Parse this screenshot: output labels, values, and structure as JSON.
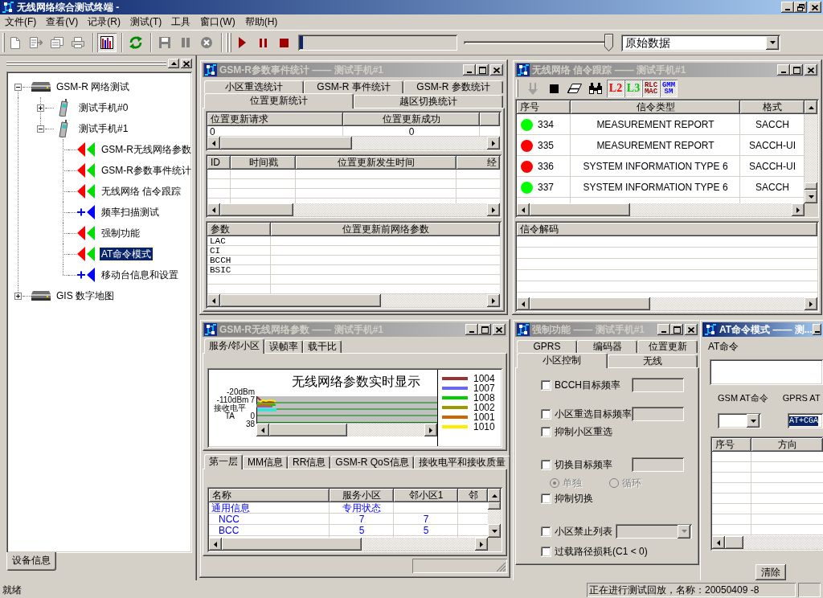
{
  "window": {
    "title": "无线网络综合测试终端 -"
  },
  "menu": [
    "文件(F)",
    "查看(V)",
    "记录(R)",
    "测试(T)",
    "工具",
    "窗口(W)",
    "帮助(H)"
  ],
  "toolbar": {
    "groups": [
      [
        {
          "disabled": true,
          "pressed": false
        },
        {
          "disabled": true,
          "pressed": false
        },
        {
          "disabled": true,
          "pressed": false
        },
        {
          "disabled": true,
          "pressed": false
        }
      ],
      [
        {
          "disabled": false,
          "pressed": true
        }
      ],
      [
        {
          "disabled": false,
          "pressed": false
        }
      ],
      [
        {
          "disabled": true,
          "pressed": false
        },
        {
          "disabled": true,
          "pressed": false
        },
        {
          "disabled": true,
          "pressed": false
        }
      ]
    ],
    "playback": {
      "buttons": [
        {
          "disabled": false
        },
        {
          "disabled": false
        },
        {
          "disabled": false
        }
      ],
      "progress": {
        "level": 0.02
      },
      "slider": {
        "level": 1
      },
      "mode": {
        "value": "原始数据"
      }
    }
  },
  "dock": {
    "tree": [
      {
        "label": "GSM-R 网络测试",
        "expanded": true,
        "selected": false,
        "children": [
          {
            "label": "测试手机#0",
            "expanded": false,
            "selected": false
          },
          {
            "label": "测试手机#1",
            "expanded": true,
            "selected": false,
            "children": [
              {
                "label": "GSM-R无线网络参数",
                "kind": "dual",
                "selected": false
              },
              {
                "label": "GSM-R参数事件统计",
                "kind": "dual",
                "selected": false
              },
              {
                "label": "无线网络 信令跟踪",
                "kind": "dual",
                "selected": false
              },
              {
                "label": "频率扫描测试",
                "kind": "single",
                "selected": false
              },
              {
                "label": "强制功能",
                "kind": "dual",
                "selected": false
              },
              {
                "label": "AT命令模式",
                "kind": "dual",
                "selected": true
              },
              {
                "label": "移动台信息和设置",
                "kind": "single",
                "selected": false
              }
            ]
          }
        ]
      },
      {
        "label": "GIS 数字地图",
        "expanded": false,
        "selected": false
      }
    ],
    "tabs": [
      {
        "label": "设备信息",
        "selected": true
      }
    ]
  },
  "windows": [
    {
      "kind": "stats",
      "title": "GSM-R参数事件统计 —— 测试手机#1",
      "active": false,
      "tab_rows": [
        [
          {
            "label": "小区重选统计",
            "selected": false
          },
          {
            "label": "GSM-R 事件统计",
            "selected": false
          },
          {
            "label": "GSM-R 参数统计",
            "selected": false
          }
        ],
        [
          {
            "label": "位置更新统计",
            "selected": true
          },
          {
            "label": "越区切换统计",
            "selected": false
          }
        ]
      ],
      "tables": [
        {
          "columns": [
            "位置更新请求",
            "位置更新成功"
          ],
          "rows": [
            [
              "0",
              "0"
            ]
          ]
        },
        {
          "columns": [
            "ID",
            "时间戳",
            "位置更新发生时间",
            "经"
          ]
        },
        {
          "columns": [
            "参数",
            "位置更新前网络参数"
          ],
          "rows": [
            [
              "LAC"
            ],
            [
              "CI"
            ],
            [
              "BCCH"
            ],
            [
              "BSIC"
            ]
          ]
        }
      ]
    },
    {
      "kind": "trace",
      "title": "无线网络 信令跟踪 —— 测试手机#1",
      "active": false,
      "tools": [
        {
          "disabled": true
        },
        {
          "disabled": false
        },
        {
          "disabled": false
        },
        {
          "disabled": false
        }
      ],
      "filters": [
        {
          "lines": [
            "L2"
          ],
          "color": "#ff0000",
          "checked": true
        },
        {
          "lines": [
            "L3"
          ],
          "color": "#00cc00",
          "checked": true
        },
        {
          "lines": [
            "RLC",
            "MAC"
          ],
          "color": "#990000",
          "checked": true
        },
        {
          "lines": [
            "GMM",
            "SM"
          ],
          "color": "#0000ff",
          "checked": true
        }
      ],
      "table": {
        "columns": [
          "序号",
          "信令类型",
          "格式"
        ],
        "rows": [
          {
            "color": "#00ff00",
            "cells": [
              "334",
              "MEASUREMENT REPORT",
              "SACCH"
            ]
          },
          {
            "color": "#ff0000",
            "cells": [
              "335",
              "MEASUREMENT REPORT",
              "SACCH-UI"
            ]
          },
          {
            "color": "#ff0000",
            "cells": [
              "336",
              "SYSTEM INFORMATION TYPE 6",
              "SACCH-UI"
            ]
          },
          {
            "color": "#00ff00",
            "cells": [
              "337",
              "SYSTEM INFORMATION TYPE 6",
              "SACCH"
            ]
          }
        ]
      },
      "decode_header": "信令解码"
    },
    {
      "kind": "params",
      "title": "GSM-R无线网络参数 —— 测试手机#1",
      "active": false,
      "tabs": [
        {
          "label": "服务/邻小区",
          "selected": true
        },
        {
          "label": "误帧率",
          "selected": false
        },
        {
          "label": "载干比",
          "selected": false
        }
      ],
      "chart": {
        "title": "无线网络参数实时显示",
        "axis_labels": [
          "-20dBm",
          "-110dBm",
          "7",
          "接收电平",
          "TA",
          "0",
          "38"
        ],
        "legend": [
          {
            "label": "1004",
            "color": "#993333"
          },
          {
            "label": "1007",
            "color": "#6666ff"
          },
          {
            "label": "1008",
            "color": "#00cc00"
          },
          {
            "label": "1002",
            "color": "#999900"
          },
          {
            "label": "1001",
            "color": "#cc6600"
          },
          {
            "label": "1010",
            "color": "#ffee00"
          }
        ]
      },
      "detail_tabs": [
        {
          "label": "第一层",
          "selected": true
        },
        {
          "label": "MM信息",
          "selected": false
        },
        {
          "label": "RR信息",
          "selected": false
        },
        {
          "label": "GSM-R QoS信息",
          "selected": false
        },
        {
          "label": "接收电平和接收质量",
          "selected": false
        }
      ],
      "table": {
        "columns": [
          "名称",
          "服务小区",
          "邻小区1",
          "邻"
        ],
        "rows": [
          {
            "kind": "group",
            "cells": [
              "通用信息",
              "专用状态"
            ]
          },
          {
            "kind": "item",
            "cells": [
              "NCC",
              "7",
              "7"
            ]
          },
          {
            "kind": "item",
            "cells": [
              "BCC",
              "5",
              "5"
            ]
          }
        ]
      }
    },
    {
      "kind": "force",
      "title": "强制功能 —— 测试手机#1",
      "active": false,
      "tab_rows": [
        [
          {
            "label": "GPRS",
            "selected": false
          },
          {
            "label": "编码器",
            "selected": false
          },
          {
            "label": "位置更新",
            "selected": false
          }
        ],
        [
          {
            "label": "小区控制",
            "selected": true
          },
          {
            "label": "无线",
            "selected": false
          }
        ]
      ],
      "options": [
        {
          "kind": "field",
          "label": "BCCH目标频率",
          "checked": false
        },
        {
          "kind": "field",
          "label": "小区重选目标频率",
          "checked": false
        },
        {
          "kind": "check",
          "label": "抑制小区重选",
          "checked": false
        },
        {
          "kind": "field",
          "label": "切换目标频率",
          "checked": false
        },
        {
          "kind": "radios",
          "disabled": true,
          "choices": [
            {
              "label": "单独",
              "selected": true
            },
            {
              "label": "循环",
              "selected": false
            }
          ]
        },
        {
          "kind": "check",
          "label": "抑制切换",
          "checked": false
        },
        {
          "kind": "combo",
          "label": "小区禁止列表",
          "checked": false,
          "disabled": true
        },
        {
          "kind": "check",
          "label": "过载路径损耗(C1 < 0)",
          "checked": false
        }
      ]
    },
    {
      "kind": "at",
      "title": "AT命令模式 —— 测...",
      "active": true,
      "command_label": "AT命令",
      "gsm_label": "GSM AT命令",
      "gprs_label": "GPRS AT",
      "gprs_value": "AT+CGA",
      "gprs_highlighted": true,
      "table": {
        "columns": [
          "序号",
          "方向"
        ]
      },
      "clear_button": "清除"
    }
  ],
  "status_bar": {
    "message": "就绪",
    "panels": [
      "正在进行测试回放，名称：20050409 -8"
    ]
  }
}
